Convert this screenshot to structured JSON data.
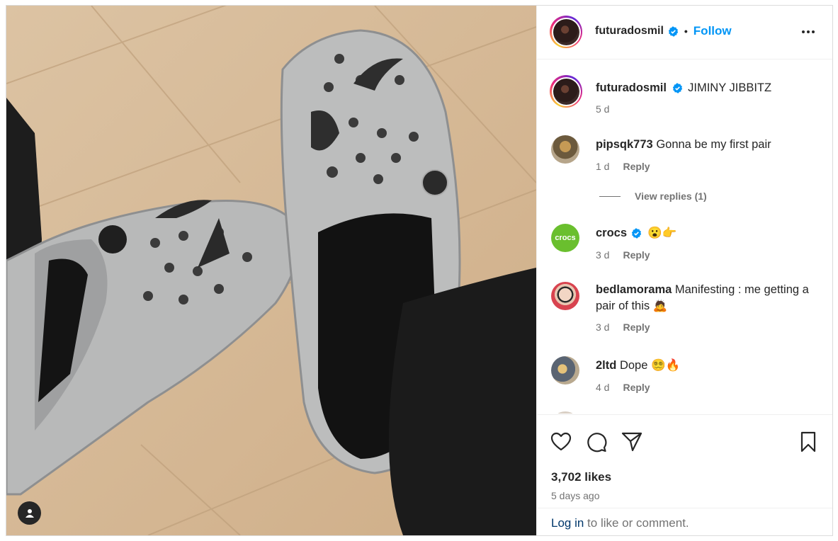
{
  "post": {
    "author": "futuradosmil",
    "follow_label": "Follow",
    "separator": "•",
    "icons": {
      "more": "more-options-icon",
      "verified": "verified-badge-icon",
      "user_tag": "user-tag-icon"
    },
    "caption": {
      "username": "futuradosmil",
      "text": "JIMINY JIBBITZ",
      "time": "5 d"
    },
    "comments": [
      {
        "username": "pipsqk773",
        "verified": false,
        "text": "Gonna be my first pair",
        "time": "1 d",
        "reply_label": "Reply"
      },
      {
        "username": "crocs",
        "verified": true,
        "text": "😮👉",
        "time": "3 d",
        "reply_label": "Reply"
      },
      {
        "username": "bedlamorama",
        "verified": false,
        "text": "Manifesting : me getting a pair of this 🙇",
        "time": "3 d",
        "reply_label": "Reply"
      },
      {
        "username": "2ltd",
        "verified": false,
        "text": "Dope 😵‍💫🔥",
        "time": "4 d",
        "reply_label": "Reply"
      }
    ],
    "view_replies_label": "View replies (1)",
    "crocs_logo_text": "crocs",
    "actions": {
      "like": "heart-icon",
      "comment": "comment-icon",
      "share": "share-icon",
      "save": "bookmark-icon"
    },
    "likes": "3,702 likes",
    "posted_ago": "5 days ago",
    "login_link": "Log in",
    "login_suffix": " to like or comment."
  },
  "colors": {
    "accent": "#0095f6",
    "verified": "#0095f6",
    "muted": "#737373",
    "crocs_green": "#6abf2e"
  }
}
